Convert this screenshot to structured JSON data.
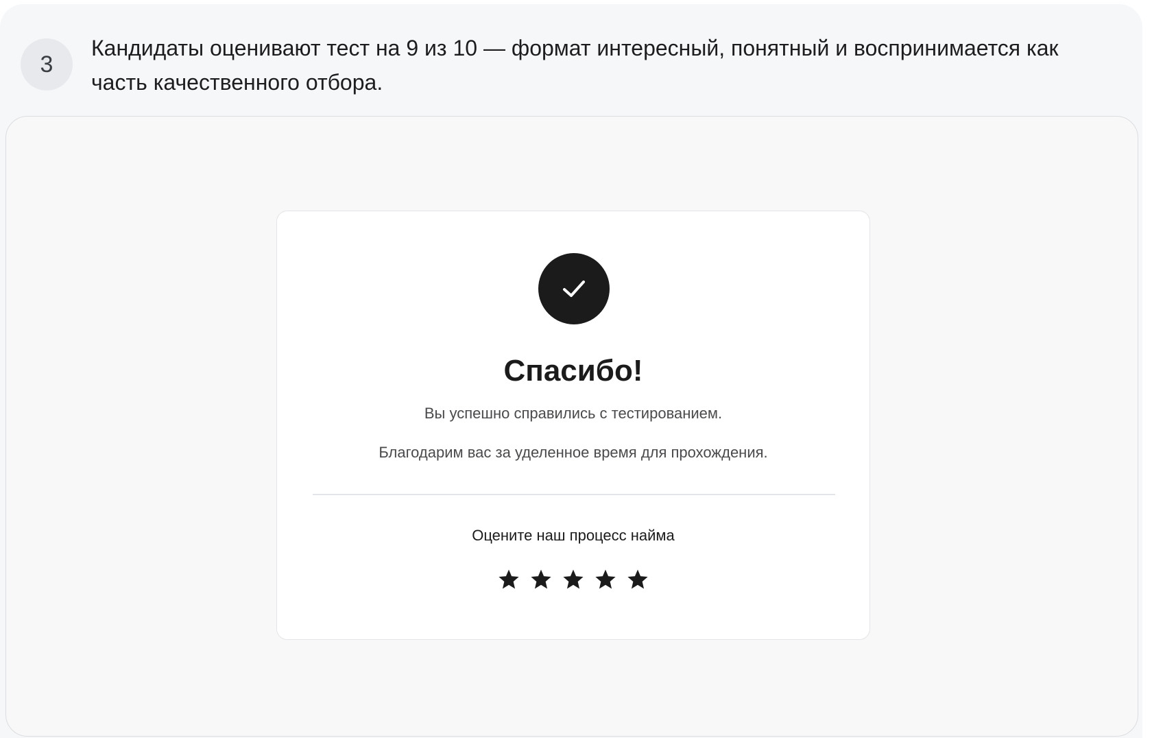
{
  "step": {
    "number": "3",
    "text": "Кандидаты оценивают тест на 9 из 10 — формат интересный, понятный и воспринимается как часть качественного отбора."
  },
  "card": {
    "icon": "check-icon",
    "title": "Спасибо!",
    "line1": "Вы успешно справились с тестированием.",
    "line2": "Благодарим вас за уделенное время для прохождения.",
    "rating_label": "Оцените наш процесс найма",
    "rating": {
      "filled": 5,
      "max": 5,
      "star_color": "#1b1b1b"
    }
  },
  "colors": {
    "panel_bg": "#f6f7f9",
    "badge_bg": "#e7e9ec",
    "accent": "#1b1b1b"
  }
}
